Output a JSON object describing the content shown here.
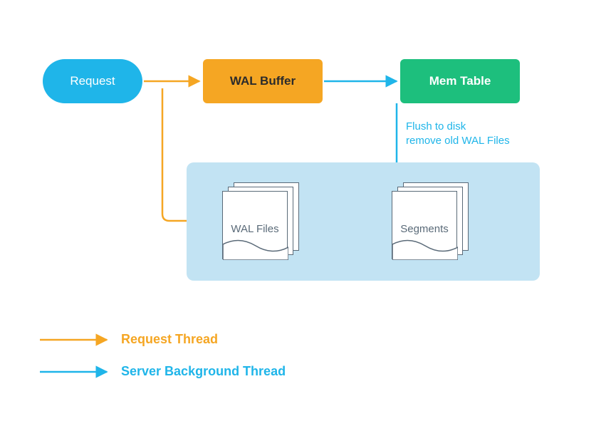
{
  "nodes": {
    "request": "Request",
    "wal_buffer": "WAL Buffer",
    "mem_table": "Mem Table",
    "wal_files": "WAL Files",
    "segments": "Segments"
  },
  "edges": {
    "flush_label_line1": "Flush to disk",
    "flush_label_line2": "remove old WAL Files"
  },
  "legend": {
    "request_thread": "Request Thread",
    "server_bg_thread": "Server Background Thread"
  },
  "colors": {
    "request_arrow": "#f5a623",
    "bg_arrow": "#1fb5e9",
    "request_fill": "#1fb5e9",
    "walbuffer_fill": "#f5a623",
    "memtable_fill": "#1dbf7d",
    "disk_container": "#c2e3f3",
    "file_border": "#5a6a78"
  }
}
